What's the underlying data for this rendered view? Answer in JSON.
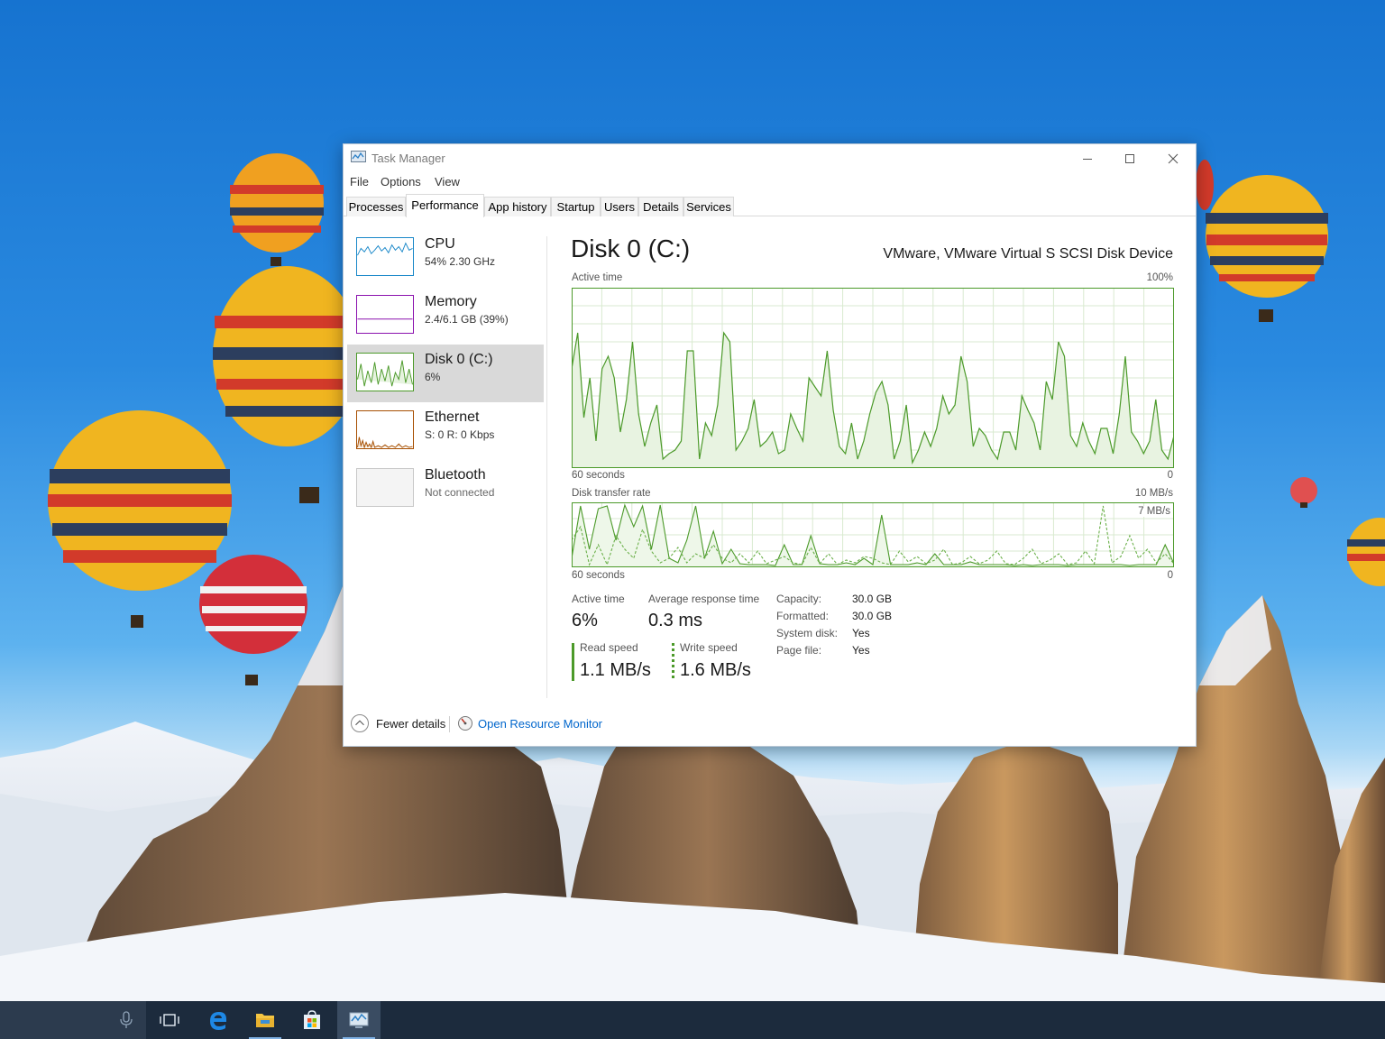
{
  "window": {
    "title": "Task Manager",
    "controls": {
      "minimize": "—",
      "maximize": "☐",
      "close": "✕"
    }
  },
  "menu": [
    "File",
    "Options",
    "View"
  ],
  "tabs": [
    "Processes",
    "Performance",
    "App history",
    "Startup",
    "Users",
    "Details",
    "Services"
  ],
  "active_tab": "Performance",
  "devices": [
    {
      "name": "CPU",
      "sub": "54%  2.30 GHz",
      "color": "#1a88c9"
    },
    {
      "name": "Memory",
      "sub": "2.4/6.1 GB (39%)",
      "color": "#8b12ae"
    },
    {
      "name": "Disk 0 (C:)",
      "sub": "6%",
      "color": "#4c9a2a",
      "selected": true
    },
    {
      "name": "Ethernet",
      "sub": "S: 0  R: 0 Kbps",
      "color": "#a74f01"
    },
    {
      "name": "Bluetooth",
      "sub": "Not connected",
      "color": "#a0a0a0"
    }
  ],
  "panel": {
    "title": "Disk 0 (C:)",
    "device": "VMware, VMware Virtual S SCSI Disk Device",
    "graph1": {
      "label": "Active time",
      "max_label": "100%",
      "time_label": "60 seconds",
      "min_label": "0",
      "values": [
        55,
        75,
        28,
        50,
        15,
        55,
        62,
        50,
        20,
        38,
        70,
        30,
        12,
        25,
        35,
        5,
        8,
        10,
        15,
        65,
        65,
        5,
        25,
        18,
        35,
        75,
        70,
        10,
        15,
        22,
        38,
        12,
        15,
        20,
        8,
        10,
        30,
        22,
        15,
        50,
        45,
        40,
        65,
        32,
        12,
        8,
        25,
        5,
        15,
        30,
        42,
        48,
        35,
        5,
        15,
        35,
        3,
        10,
        20,
        12,
        22,
        40,
        30,
        35,
        62,
        48,
        12,
        22,
        18,
        10,
        5,
        20,
        20,
        10,
        40,
        32,
        25,
        10,
        48,
        38,
        70,
        62,
        18,
        12,
        25,
        15,
        8,
        22,
        22,
        8,
        30,
        62,
        20,
        15,
        8,
        15,
        38,
        10,
        5,
        18
      ]
    },
    "graph2": {
      "label": "Disk transfer rate",
      "max_label": "10 MB/s",
      "inner_label": "7 MB/s",
      "time_label": "60 seconds",
      "min_label": "0",
      "read_series": [
        1.0,
        6.8,
        2.0,
        6.5,
        6.8,
        3.0,
        6.9,
        4.5,
        6.8,
        2.0,
        6.9,
        1.0,
        0.5,
        3.0,
        6.8,
        1.0,
        4.0,
        0.4,
        2.0,
        0.4,
        0.3,
        0.3,
        0.3,
        0.2,
        2.5,
        0.3,
        0.3,
        3.5,
        0.4,
        0.3,
        0.3,
        0.5,
        0.3,
        1.0,
        0.3,
        5.8,
        0.3,
        0.3,
        0.3,
        0.5,
        0.3,
        1.5,
        0.3,
        0.3,
        0.3,
        0.6,
        0.3,
        0.3,
        0.3,
        0.3,
        0.2,
        0.3,
        0.2,
        0.3,
        0.3,
        0.3,
        0.2,
        0.3,
        0.3,
        0.3,
        0.3,
        0.3,
        0.3,
        0.2,
        0.3,
        0.3,
        0.3,
        2.5,
        0.4
      ],
      "write_series": [
        3.0,
        4.5,
        0.3,
        2.5,
        0.3,
        3.5,
        2.0,
        1.0,
        4.2,
        1.8,
        0.5,
        1.0,
        2.2,
        0.5,
        1.5,
        1.0,
        2.5,
        1.0,
        0.5,
        1.5,
        0.5,
        1.8,
        0.4,
        0.8,
        1.2,
        0.5,
        0.3,
        2.2,
        0.4,
        1.5,
        0.3,
        0.8,
        0.5,
        1.2,
        1.0,
        0.5,
        0.3,
        1.8,
        0.6,
        1.2,
        0.4,
        0.8,
        2.0,
        0.3,
        0.5,
        1.2,
        0.4,
        0.8,
        1.8,
        0.4,
        0.3,
        1.0,
        2.0,
        0.4,
        0.8,
        1.5,
        0.3,
        0.5,
        1.8,
        0.4,
        6.8,
        0.5,
        1.2,
        3.5,
        1.0,
        2.0,
        0.5,
        1.5,
        0.4
      ]
    },
    "stats": {
      "active_time_label": "Active time",
      "active_time": "6%",
      "avg_response_label": "Average response time",
      "avg_response": "0.3 ms",
      "read_label": "Read speed",
      "read_value": "1.1 MB/s",
      "write_label": "Write speed",
      "write_value": "1.6 MB/s"
    },
    "info": [
      {
        "label": "Capacity:",
        "value": "30.0 GB"
      },
      {
        "label": "Formatted:",
        "value": "30.0 GB"
      },
      {
        "label": "System disk:",
        "value": "Yes"
      },
      {
        "label": "Page file:",
        "value": "Yes"
      }
    ]
  },
  "footer": {
    "fewer_details": "Fewer details",
    "resource_monitor": "Open Resource Monitor"
  },
  "taskbar": {
    "icons": [
      "microphone-icon",
      "task-view-icon",
      "edge-browser-icon",
      "file-explorer-icon",
      "store-icon",
      "task-manager-icon"
    ]
  }
}
